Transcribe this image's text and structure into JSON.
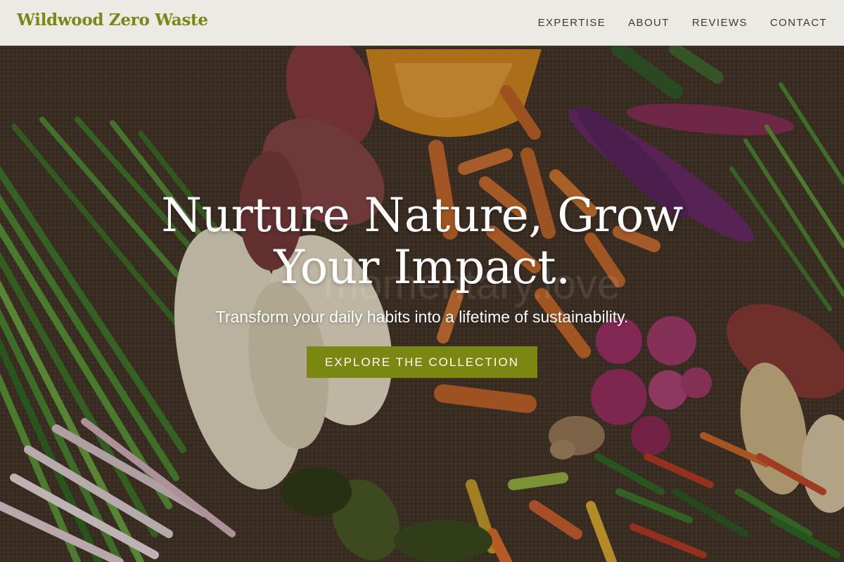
{
  "brand": {
    "name": "Wildwood Zero Waste",
    "color": "#7a8710"
  },
  "nav": {
    "items": [
      {
        "label": "EXPERTISE"
      },
      {
        "label": "ABOUT"
      },
      {
        "label": "REVIEWS"
      },
      {
        "label": "CONTACT"
      }
    ]
  },
  "hero": {
    "title_line1": "Nurture Nature, Grow",
    "title_line2": "Your Impact.",
    "subtitle": "Transform your daily habits into a lifetime of sustainability.",
    "cta_label": "EXPLORE THE COLLECTION",
    "watermark": "momentary.love",
    "background": "vegetables-on-burlap-photo"
  },
  "colors": {
    "accent": "#7a8710",
    "nav_bg": "#f6f5f1",
    "nav_text": "#3a3a3a"
  }
}
